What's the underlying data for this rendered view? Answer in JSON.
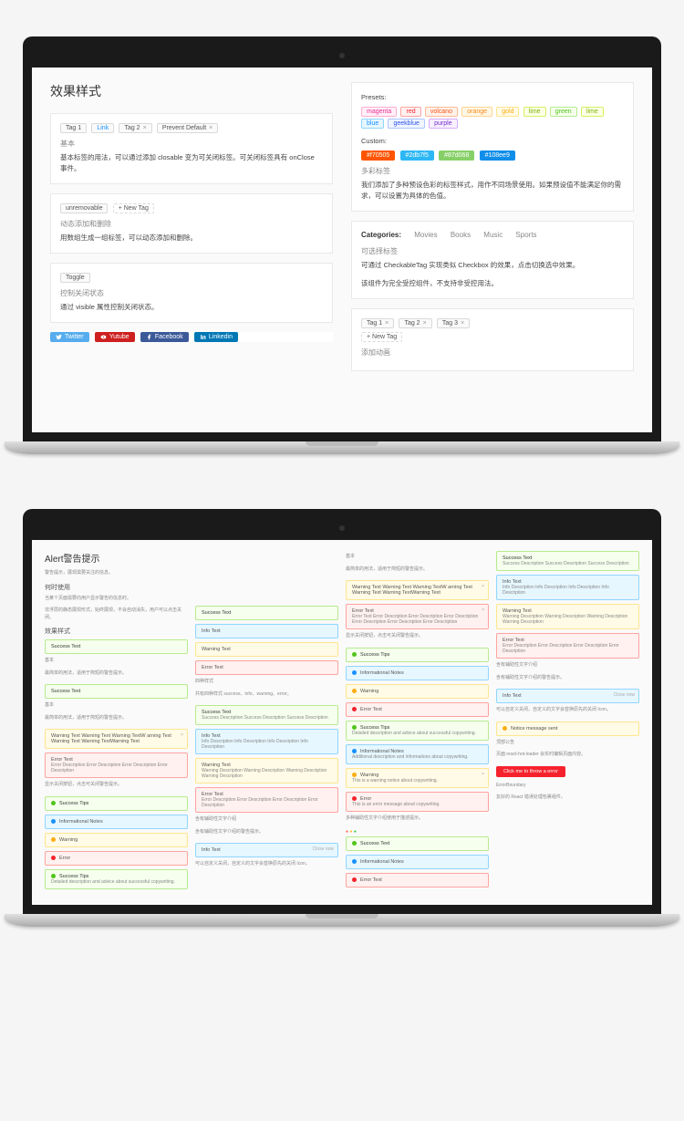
{
  "laptop1": {
    "title": "效果样式",
    "left": {
      "tags_row": {
        "tag1": "Tag 1",
        "link": "Link",
        "tag2": "Tag 2",
        "prevent": "Prevent Default"
      },
      "basic": {
        "title": "基本",
        "desc": "基本标签的用法，可以通过添加 closable 变为可关闭标签。可关闭标签具有 onClose 事件。"
      },
      "dynamic": {
        "unremovable": "unremovable",
        "new_tag": "+ New Tag",
        "title": "动态添加和删除",
        "desc": "用数组生成一组标签，可以动态添加和删除。"
      },
      "toggle": {
        "btn": "Toggle",
        "title": "控制关闭状态",
        "desc": "通过 visible 属性控制关闭状态。"
      },
      "social": {
        "twitter": "Twitter",
        "youtube": "Yutube",
        "facebook": "Facebook",
        "linkedin": "Linkedin"
      }
    },
    "right": {
      "presets_label": "Presets:",
      "presets": [
        "magenta",
        "red",
        "volcano",
        "orange",
        "gold",
        "lime",
        "green",
        "lime",
        "blue",
        "geekblue",
        "purple"
      ],
      "custom_label": "Custom:",
      "custom": [
        {
          "text": "#f70505",
          "bg": "#f50"
        },
        {
          "text": "#2db7f5",
          "bg": "#2db7f5"
        },
        {
          "text": "#87d068",
          "bg": "#87d068"
        },
        {
          "text": "#108ee9",
          "bg": "#108ee9"
        }
      ],
      "colors": {
        "title": "多彩标签",
        "desc": "我们添加了多种预设色彩的标签样式，用作不同场景使用。如果预设值不能满足你的需求，可以设置为具体的色值。"
      },
      "categories": {
        "label": "Categories:",
        "items": [
          "Movies",
          "Books",
          "Music",
          "Sports"
        ]
      },
      "checkable": {
        "title": "可选择标签",
        "line1": "可通过 CheckableTag 实现类似 Checkbox 的效果，点击切换选中效果。",
        "line2": "该组件为完全受控组件，不支持非受控用法。"
      },
      "anim": {
        "tag1": "Tag 1",
        "tag2": "Tag 2",
        "tag3": "Tag 3",
        "new": "+ New Tag",
        "title": "添加动画"
      }
    }
  },
  "laptop2": {
    "title": "Alert警告提示",
    "intro1": "警告提示，展现需要关注的信息。",
    "when_title": "何时使用",
    "when1": "当某个页面需要向用户显示警告的信息时。",
    "when2": "非浮层的静态展现形式，始终展现，不会自动消失，用户可以点击关闭。",
    "style_title": "效果样式",
    "basic_title": "基本",
    "basic_desc": "最简单的用法，适用于简短的警告提示。",
    "types_title": "四种样式",
    "types_desc": "共有四种样式 success、info、warning、error。",
    "closable_desc": "显示关闭按钮，点击可关闭警告提示。",
    "icon_title": "含有辅助性文字介绍",
    "icon_desc": "含有辅助性文字介绍的警告提示。",
    "icon2_desc": "多种辅助性文字介绍使用于描述提示。",
    "close_text": "Close now",
    "close_desc": "可以自定义关闭，自定义的文字会替换原先的关闭 Icon。",
    "smooth_title": "顶部公告",
    "smooth_desc": "页面 react-hot-loader 会实时编辑页面内容。",
    "err_btn": "Click me to throw a error",
    "boundary_title": "ErrorBoundary",
    "boundary_desc": "友好的 React 错误处理包裹组件。",
    "notice": "Notice message sent",
    "alerts": {
      "success": "Success Text",
      "info": "Info Text",
      "warning": "Warning Text",
      "error": "Error Text",
      "success_tips": "Success Tips",
      "info_notes": "Informational Notes",
      "warning_s": "Warning",
      "error_s": "Error",
      "warning_long": "Warning Text Warning Text Warning TextW arning Text Warning Text Warning TextWarning Text",
      "error_long": "Error Text Error Description Error Description Error Description Error Description Error Description Error Description",
      "desc_success": "Success Description Success Description Success Description",
      "desc_info": "Info Description Info Description Info Description Info Description",
      "desc_warn": "Warning Description Warning Description Warning Description Warning Description",
      "desc_err": "Error Description Error Description Error Description Error Description",
      "detail_success": "Detailed description and advice about successful copywriting.",
      "detail_info": "Additional description and informations about copywriting.",
      "detail_warn": "This is a warning notice about copywriting.",
      "detail_err": "This is an error message about copywriting."
    }
  }
}
